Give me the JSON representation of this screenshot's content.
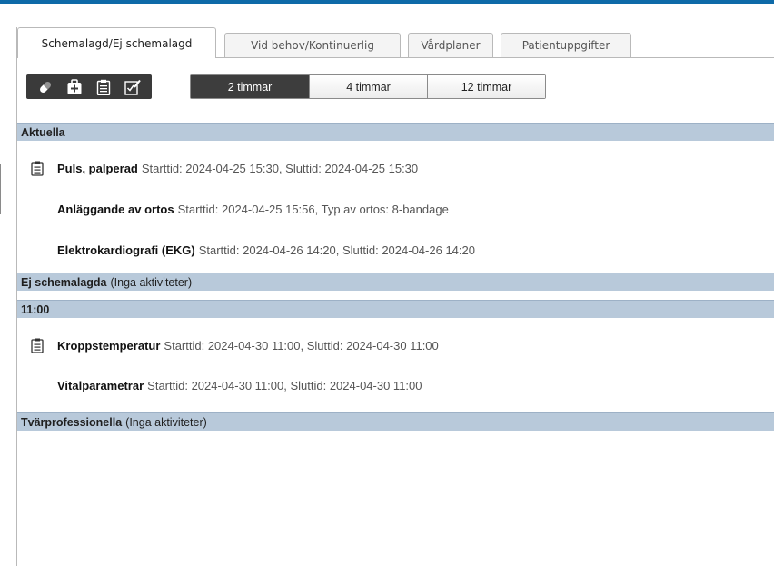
{
  "tabs": [
    {
      "label": "Schemalagd/Ej schemalagd",
      "active": true
    },
    {
      "label": "Vid behov/Kontinuerlig",
      "active": false
    },
    {
      "label": "Vårdplaner",
      "active": false
    },
    {
      "label": "Patientuppgifter",
      "active": false
    }
  ],
  "toolbar": {
    "icons": [
      "pill-icon",
      "medical-kit-add-icon",
      "clipboard-icon",
      "edit-checklist-icon"
    ]
  },
  "time_range": {
    "options": [
      "2 timmar",
      "4 timmar",
      "12 timmar"
    ],
    "selected": "2 timmar"
  },
  "sections": [
    {
      "title": "Aktuella",
      "note": "",
      "rows": [
        {
          "icon": "clipboard-icon",
          "name": "Puls, palperad",
          "detail": "Starttid: 2024-04-25 15:30, Sluttid: 2024-04-25 15:30"
        },
        {
          "icon": "",
          "name": "Anläggande av ortos",
          "detail": "Starttid: 2024-04-25 15:56, Typ av ortos: 8-bandage"
        },
        {
          "icon": "",
          "name": "Elektrokardiografi (EKG)",
          "detail": "Starttid: 2024-04-26 14:20, Sluttid: 2024-04-26 14:20"
        }
      ]
    },
    {
      "title": "Ej schemalagda",
      "note": "(Inga aktiviteter)",
      "rows": []
    },
    {
      "title": "11:00",
      "note": "",
      "rows": [
        {
          "icon": "clipboard-icon",
          "name": "Kroppstemperatur",
          "detail": "Starttid: 2024-04-30 11:00, Sluttid: 2024-04-30 11:00"
        },
        {
          "icon": "",
          "name": "Vitalparametrar",
          "detail": "Starttid: 2024-04-30 11:00, Sluttid: 2024-04-30 11:00"
        }
      ]
    },
    {
      "title": "Tvärprofessionella",
      "note": "(Inga aktiviteter)",
      "rows": []
    }
  ],
  "colors": {
    "accent_top": "#0e6aa8",
    "section_header": "#b8c9da",
    "toolbar_dark": "#3a3a3a"
  }
}
